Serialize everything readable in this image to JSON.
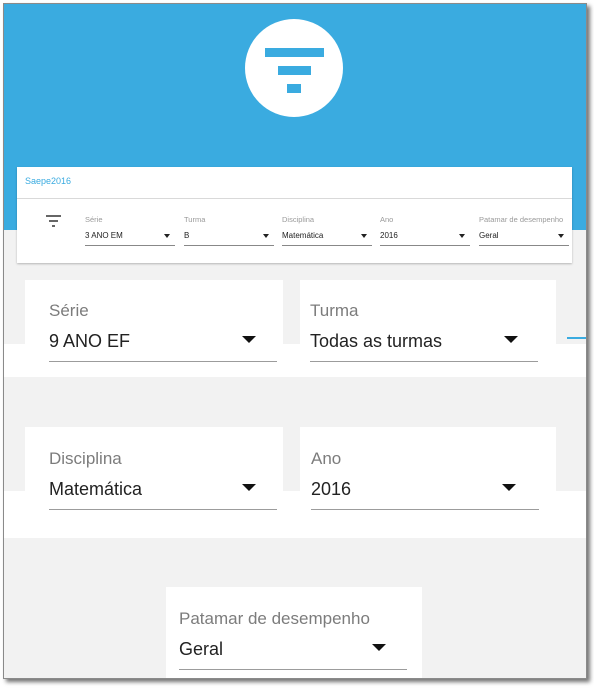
{
  "colors": {
    "primary": "#3aabe0",
    "background": "#f2f2f2",
    "card": "#ffffff"
  },
  "header": {
    "icon": "filter-icon"
  },
  "summary": {
    "title": "Saepe2016",
    "icon": "filter-icon",
    "fields": [
      {
        "label": "Série",
        "value": "3 ANO EM"
      },
      {
        "label": "Turma",
        "value": "B"
      },
      {
        "label": "Disciplina",
        "value": "Matemática"
      },
      {
        "label": "Ano",
        "value": "2016"
      },
      {
        "label": "Patamar de desempenho",
        "value": "Geral"
      }
    ]
  },
  "filters": {
    "serie": {
      "label": "Série",
      "value": "9 ANO EF"
    },
    "turma": {
      "label": "Turma",
      "value": "Todas as turmas"
    },
    "disciplina": {
      "label": "Disciplina",
      "value": "Matemática"
    },
    "ano": {
      "label": "Ano",
      "value": "2016"
    },
    "patamar": {
      "label": "Patamar de desempenho",
      "value": "Geral"
    }
  }
}
